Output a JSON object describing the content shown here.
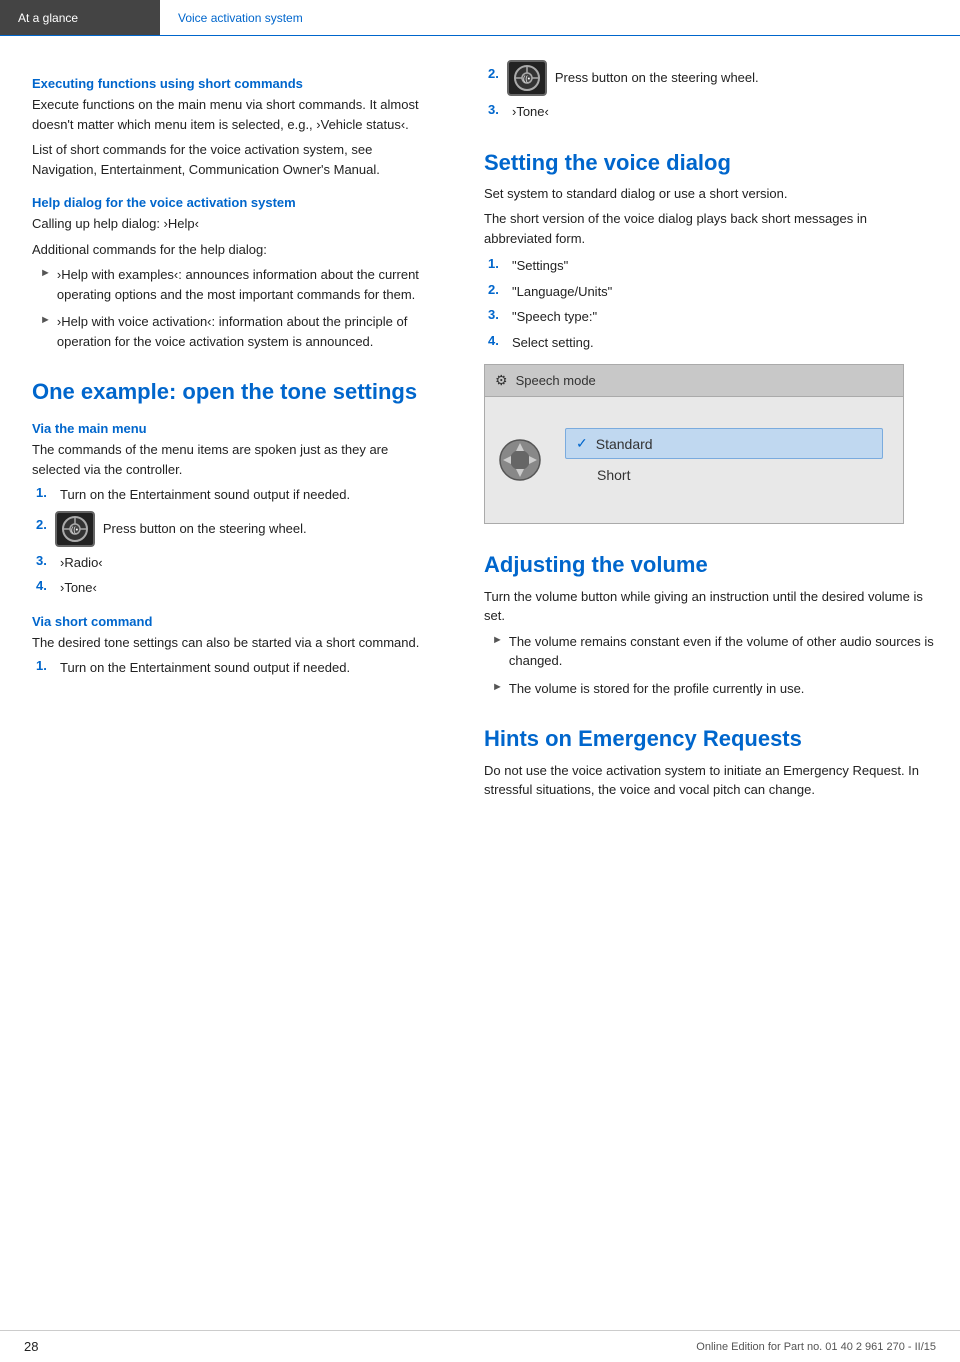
{
  "header": {
    "left_label": "At a glance",
    "right_label": "Voice activation system"
  },
  "left_col": {
    "section1": {
      "heading": "Executing functions using short commands",
      "para1": "Execute functions on the main menu via short commands. It almost doesn't matter which menu item is selected, e.g., ›Vehicle status‹.",
      "para2": "List of short commands for the voice activation system, see Navigation, Entertainment, Communication Owner's Manual."
    },
    "section2": {
      "heading": "Help dialog for the voice activation system",
      "para1": "Calling up help dialog: ›Help‹",
      "para2": "Additional commands for the help dialog:",
      "bullets": [
        "›Help with examples‹: announces information about the current operating options and the most important commands for them.",
        "›Help with voice activation‹: information about the principle of operation for the voice activation system is announced."
      ]
    },
    "section3": {
      "heading": "One example: open the tone settings",
      "subsection1": {
        "heading": "Via the main menu",
        "para": "The commands of the menu items are spoken just as they are selected via the controller.",
        "steps": [
          {
            "num": "1.",
            "text": "Turn on the Entertainment sound output if needed."
          },
          {
            "num": "2.",
            "text": "Press button on the steering wheel."
          },
          {
            "num": "3.",
            "text": "›Radio‹"
          },
          {
            "num": "4.",
            "text": "›Tone‹"
          }
        ]
      },
      "subsection2": {
        "heading": "Via short command",
        "para": "The desired tone settings can also be started via a short command.",
        "steps": [
          {
            "num": "1.",
            "text": "Turn on the Entertainment sound output if needed."
          }
        ]
      }
    }
  },
  "right_col": {
    "section_step2": {
      "step_num": "2.",
      "step_text": "Press button on the steering wheel.",
      "step3": "3.",
      "step3_text": "›Tone‹"
    },
    "section_voice_dialog": {
      "heading": "Setting the voice dialog",
      "para1": "Set system to standard dialog or use a short version.",
      "para2": "The short version of the voice dialog plays back short messages in abbreviated form.",
      "steps": [
        {
          "num": "1.",
          "text": "\"Settings\""
        },
        {
          "num": "2.",
          "text": "\"Language/Units\""
        },
        {
          "num": "3.",
          "text": "\"Speech type:\""
        },
        {
          "num": "4.",
          "text": "Select setting."
        }
      ],
      "speech_mode": {
        "title": "Speech mode",
        "option1": "Standard",
        "option2": "Short"
      }
    },
    "section_volume": {
      "heading": "Adjusting the volume",
      "para": "Turn the volume button while giving an instruction until the desired volume is set.",
      "bullets": [
        "The volume remains constant even if the volume of other audio sources is changed.",
        "The volume is stored for the profile currently in use."
      ]
    },
    "section_emergency": {
      "heading": "Hints on Emergency Requests",
      "para": "Do not use the voice activation system to initiate an Emergency Request. In stressful situations, the voice and vocal pitch can change."
    }
  },
  "footer": {
    "page_num": "28",
    "copyright": "Online Edition for Part no. 01 40 2 961 270 - II/15"
  }
}
